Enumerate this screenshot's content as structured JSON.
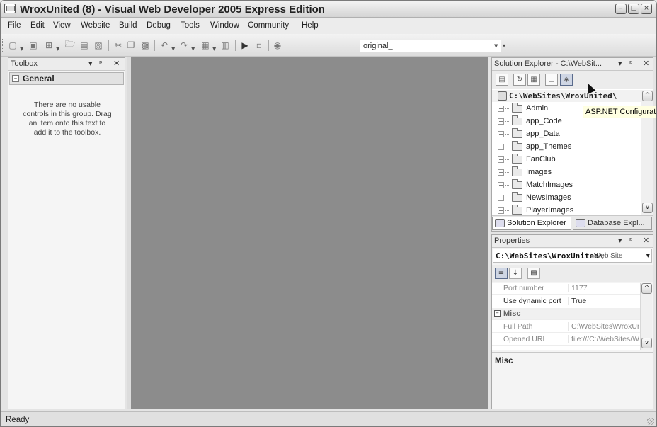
{
  "window": {
    "title": "WroxUnited (8) - Visual Web Developer 2005 Express Edition"
  },
  "menu": [
    "File",
    "Edit",
    "View",
    "Website",
    "Build",
    "Debug",
    "Tools",
    "Window",
    "Community",
    "Help"
  ],
  "toolbar": {
    "solution_config": "original_"
  },
  "toolbox": {
    "title": "Toolbox",
    "group": "General",
    "empty_message": "There are no usable controls in this group. Drag an item onto this text to add it to the toolbox."
  },
  "solution_explorer": {
    "title": "Solution Explorer - C:\\WebSit...",
    "root": "C:\\WebSites\\WroxUnited\\",
    "items": [
      "Admin",
      "app_Code",
      "app_Data",
      "app_Themes",
      "FanClub",
      "Images",
      "MatchImages",
      "NewsImages",
      "PlayerImages"
    ],
    "tooltip": "ASP.NET Configuration"
  },
  "tabs": {
    "solution_explorer": "Solution Explorer",
    "database_explorer": "Database Expl..."
  },
  "properties": {
    "title": "Properties",
    "object_name": "C:\\WebSites\\WroxUnited\\",
    "object_type": "Web Site",
    "rows": [
      {
        "name": "Port number",
        "value": "1177"
      },
      {
        "name": "Use dynamic port",
        "value": "True"
      }
    ],
    "category": "Misc",
    "misc_rows": [
      {
        "name": "Full Path",
        "value": "C:\\WebSites\\WroxUnited\\"
      },
      {
        "name": "Opened URL",
        "value": "file:///C:/WebSites/WroxUnited/"
      }
    ],
    "description_title": "Misc"
  },
  "status": {
    "text": "Ready"
  }
}
